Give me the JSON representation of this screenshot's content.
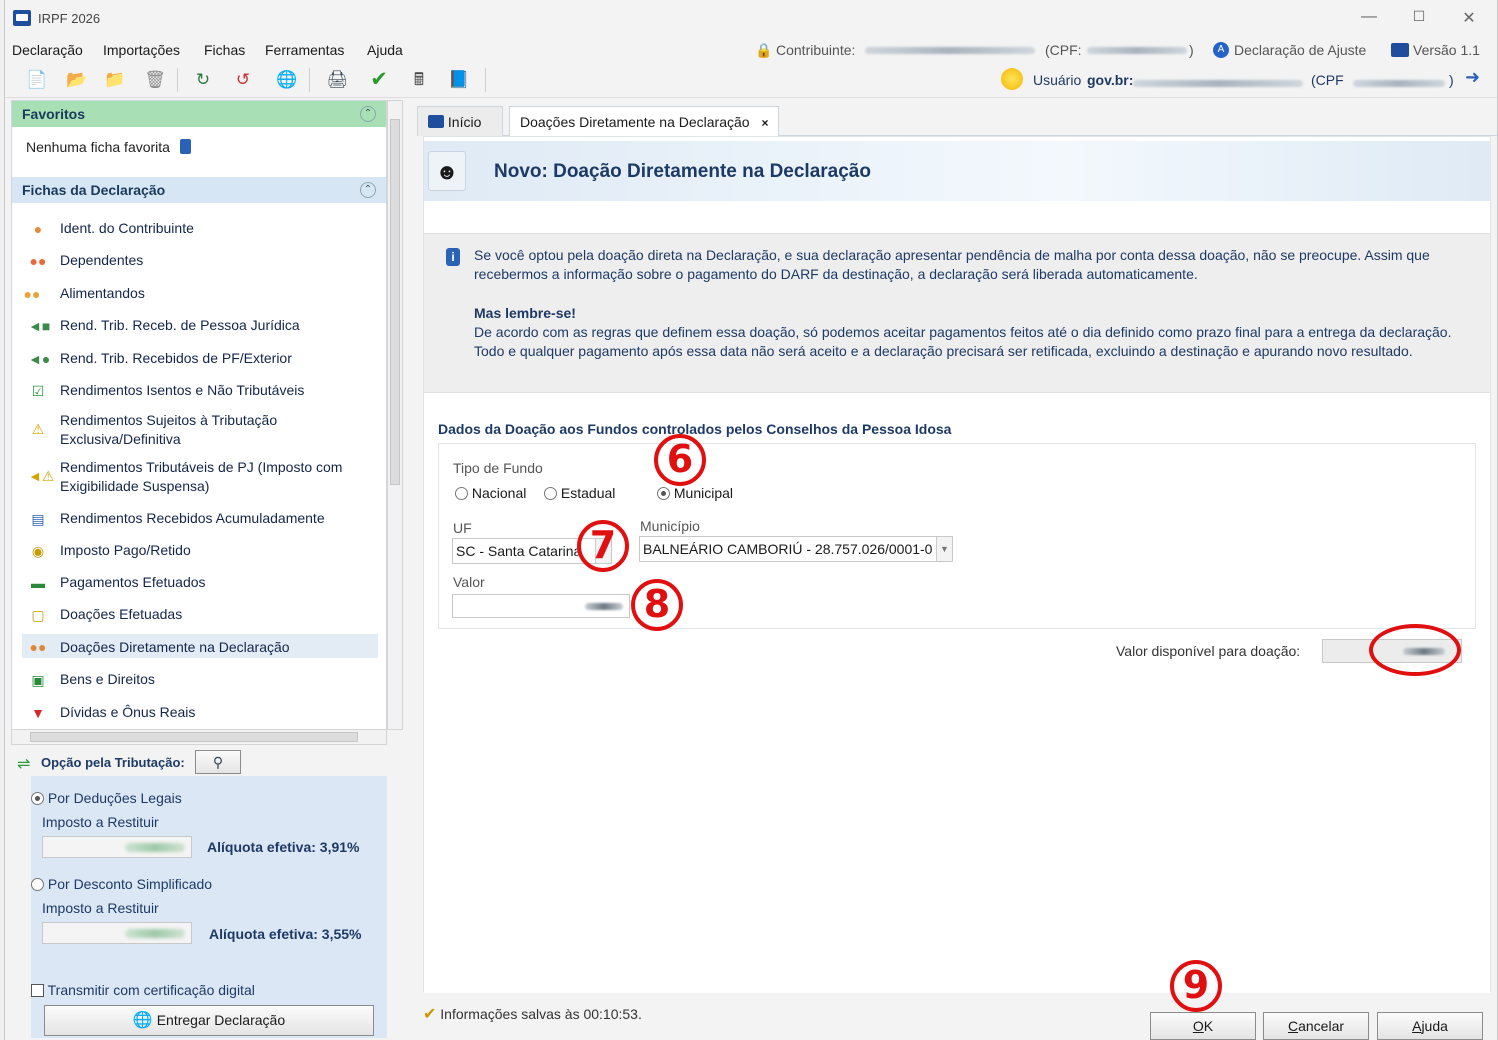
{
  "window": {
    "title": "IRPF 2026"
  },
  "menu": {
    "items": [
      "Declaração",
      "Importações",
      "Fichas",
      "Ferramentas",
      "Ajuda"
    ],
    "contribuinte_label": "Contribuinte:",
    "cpf_open": "(CPF:",
    "cpf_close": ")",
    "declaracao": "Declaração de Ajuste",
    "versao": "Versão 1.1"
  },
  "toolbar": {
    "usuario_label": "Usuário",
    "usuario_brand": "gov.br:",
    "cpf_open": "(CPF",
    "cpf_close": ")"
  },
  "sidebar": {
    "favoritos_title": "Favoritos",
    "favoritos_empty": "Nenhuma ficha favorita",
    "fichas_title": "Fichas da Declaração",
    "items": [
      "Ident. do Contribuinte",
      "Dependentes",
      "Alimentandos",
      "Rend. Trib. Receb. de Pessoa Jurídica",
      "Rend. Trib. Recebidos de PF/Exterior",
      "Rendimentos Isentos e Não Tributáveis",
      "Rendimentos Sujeitos à Tributação Exclusiva/Definitiva",
      "Rendimentos Tributáveis de PJ (Imposto com Exigibilidade Suspensa)",
      "Rendimentos Recebidos Acumuladamente",
      "Imposto Pago/Retido",
      "Pagamentos Efetuados",
      "Doações Efetuadas",
      "Doações Diretamente na Declaração",
      "Bens e Direitos",
      "Dívidas e Ônus Reais"
    ],
    "selected_index": 12
  },
  "tributacao": {
    "title": "Opção pela Tributação:",
    "deducoes_label": "Por Deduções Legais",
    "deducoes_imposto_label": "Imposto a Restituir",
    "deducoes_aliquota": "Alíquota efetiva: 3,91%",
    "simplificado_label": "Por Desconto Simplificado",
    "simplificado_imposto_label": "Imposto a Restituir",
    "simplificado_aliquota": "Alíquota efetiva: 3,55%",
    "certificado_label": "Transmitir com certificação digital",
    "entregar_label": "Entregar Declaração"
  },
  "tabs": [
    {
      "label": "Início"
    },
    {
      "label": "Doações Diretamente na Declaração",
      "close": "×"
    }
  ],
  "page": {
    "title": "Novo: Doação Diretamente na Declaração",
    "info_p1": "Se você optou pela doação direta na Declaração, e sua declaração apresentar pendência de malha por conta dessa doação, não se preocupe. Assim que recebermos a informação sobre o pagamento do DARF da destinação, a declaração será liberada automaticamente.",
    "info_title": "Mas lembre-se!",
    "info_p2": "De acordo com as regras que definem essa doação, só podemos aceitar pagamentos feitos até o dia definido como prazo final para a entrega da declaração. Todo e qualquer pagamento após essa data não será aceito e a declaração precisará ser retificada, excluindo a destinação e apurando novo resultado.",
    "section_title": "Dados da Doação aos Fundos controlados pelos Conselhos da Pessoa Idosa",
    "tipo_fundo_label": "Tipo de Fundo",
    "fundo_options": [
      "Nacional",
      "Estadual",
      "Municipal"
    ],
    "fundo_selected": "Municipal",
    "uf_label": "UF",
    "uf_value": "SC - Santa Catarina",
    "municipio_label": "Município",
    "municipio_value": "BALNEÁRIO CAMBORIÚ - 28.757.026/0001-0",
    "valor_label": "Valor",
    "disponivel_label": "Valor disponível para doação:"
  },
  "footer": {
    "status": "Informações salvas às 00:10:53.",
    "ok": "OK",
    "ok_key": "O",
    "ok_rest": "K",
    "cancelar_key": "C",
    "cancelar_rest": "ancelar",
    "ajuda_key": "A",
    "ajuda_rest": "juda"
  },
  "annotations": [
    "6",
    "7",
    "8",
    "9"
  ],
  "colors": {
    "accent": "#1d3a66",
    "annotation": "#e01010",
    "favoritos_bg": "#a9dfb4",
    "fichas_bg": "#d7e6f4"
  }
}
